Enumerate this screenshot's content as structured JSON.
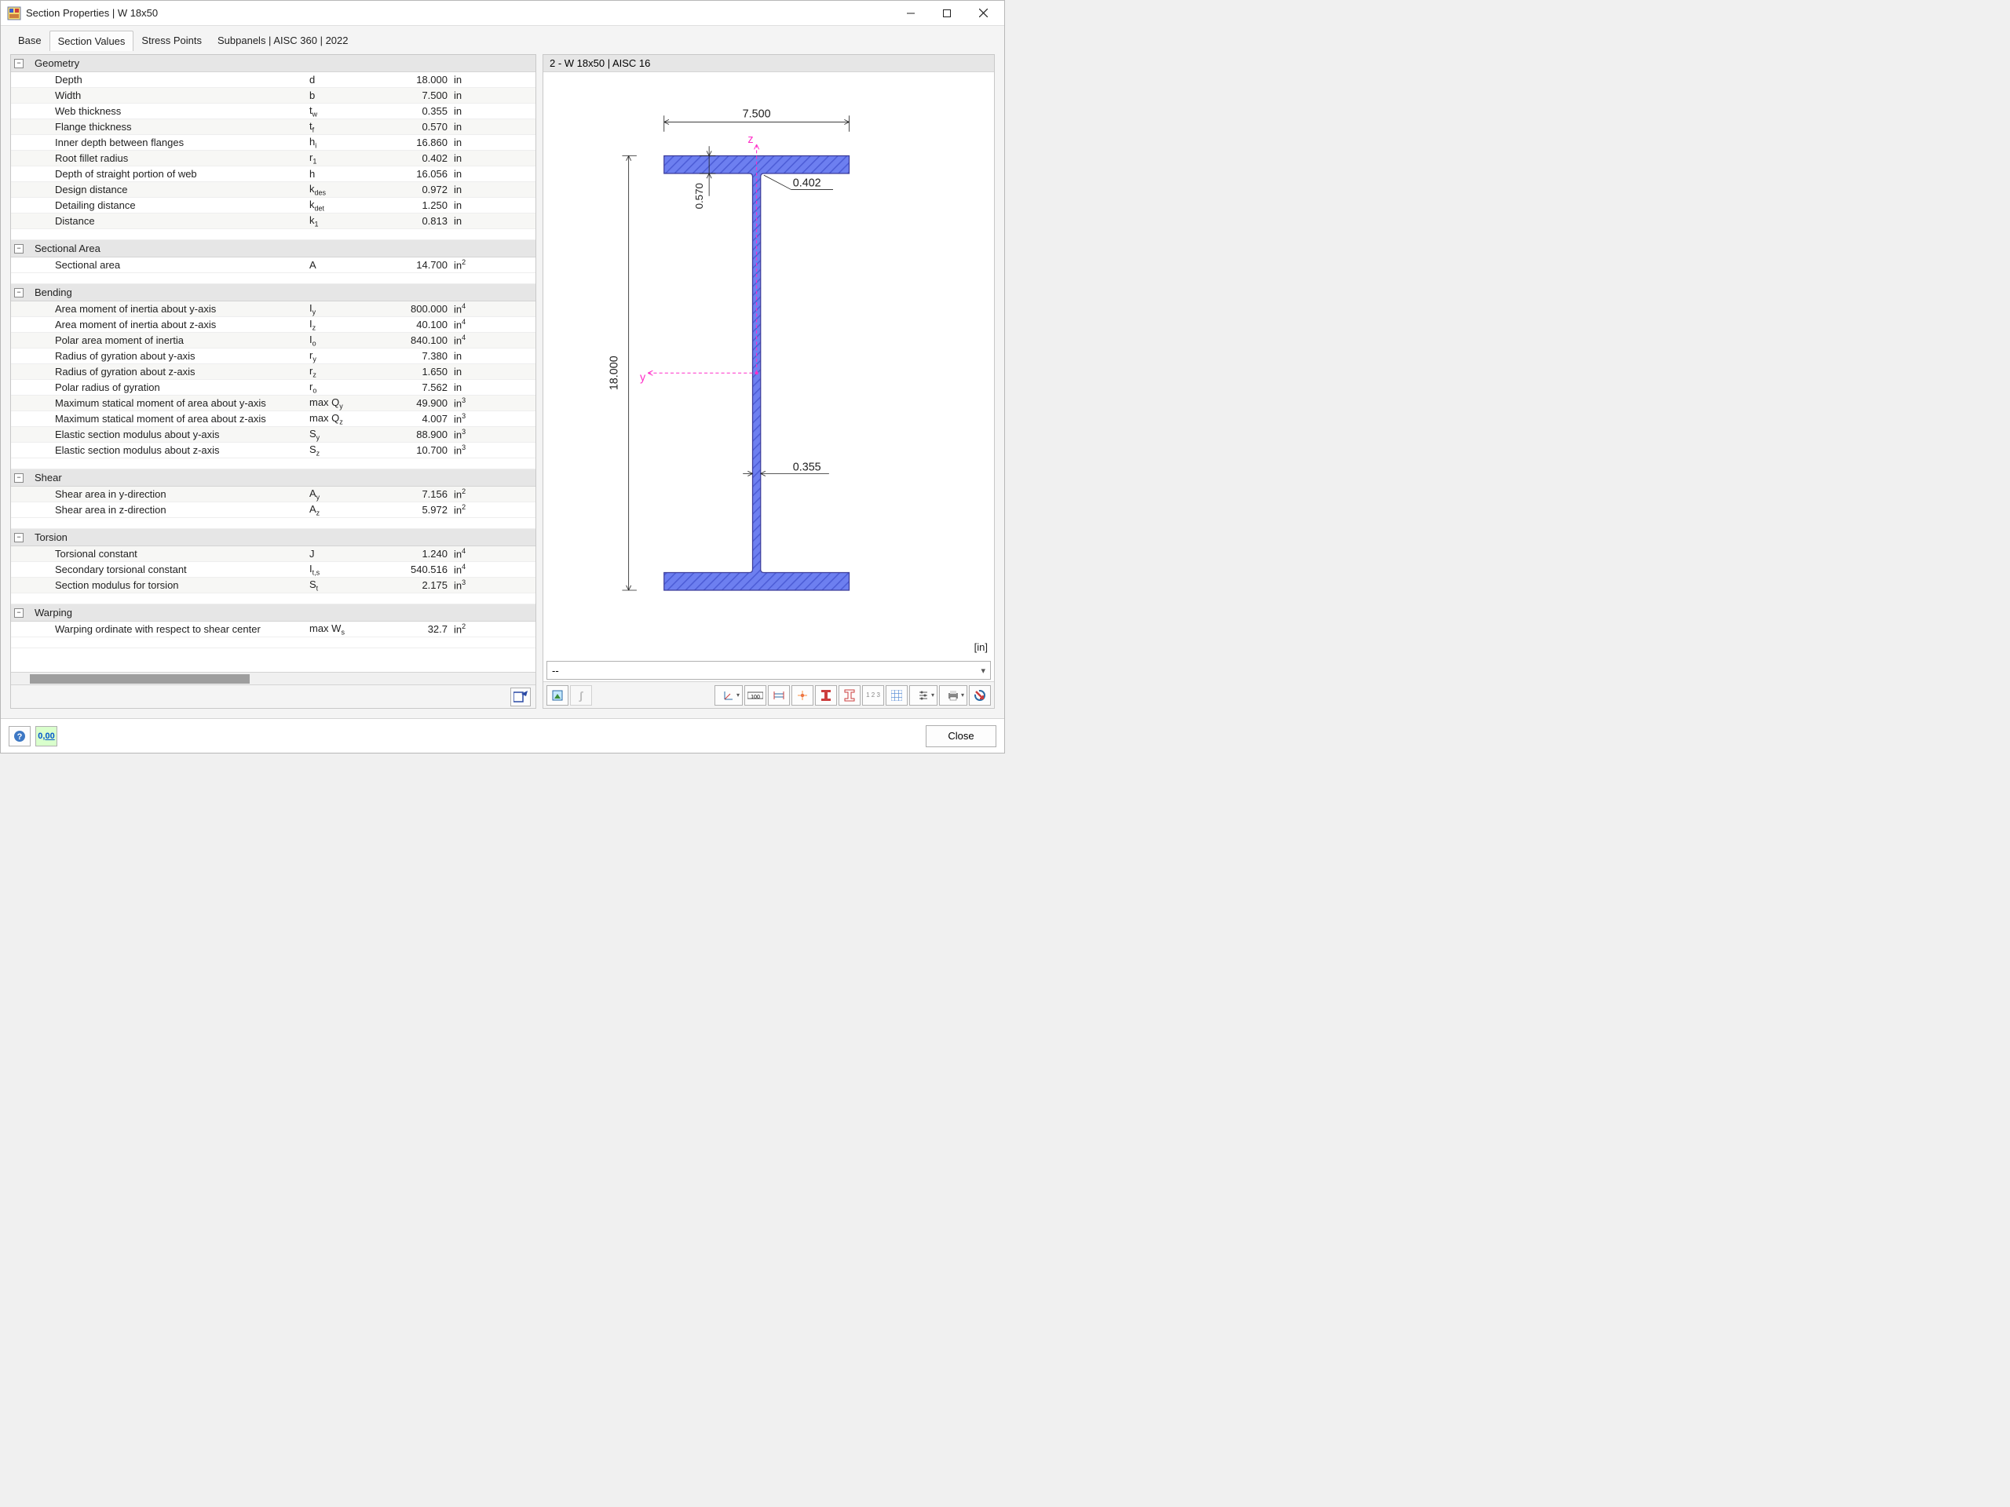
{
  "window": {
    "title": "Section Properties | W 18x50"
  },
  "tabs": [
    {
      "label": "Base",
      "active": false
    },
    {
      "label": "Section Values",
      "active": true
    },
    {
      "label": "Stress Points",
      "active": false
    },
    {
      "label": "Subpanels | AISC 360 | 2022",
      "active": false
    }
  ],
  "right": {
    "header": "2 - W 18x50 | AISC 16",
    "units": "[in]",
    "combo_value": "--"
  },
  "footer": {
    "close": "Close"
  },
  "groups": [
    {
      "name": "Geometry",
      "rows": [
        {
          "desc": "Depth",
          "sym": "d",
          "val": "18.000",
          "unit": "in"
        },
        {
          "desc": "Width",
          "sym": "b",
          "val": "7.500",
          "unit": "in"
        },
        {
          "desc": "Web thickness",
          "sym": "t<sub>w</sub>",
          "val": "0.355",
          "unit": "in"
        },
        {
          "desc": "Flange thickness",
          "sym": "t<sub>f</sub>",
          "val": "0.570",
          "unit": "in"
        },
        {
          "desc": "Inner depth between flanges",
          "sym": "h<sub>i</sub>",
          "val": "16.860",
          "unit": "in"
        },
        {
          "desc": "Root fillet radius",
          "sym": "r<sub>1</sub>",
          "val": "0.402",
          "unit": "in"
        },
        {
          "desc": "Depth of straight portion of web",
          "sym": "h",
          "val": "16.056",
          "unit": "in"
        },
        {
          "desc": "Design distance",
          "sym": "k<sub>des</sub>",
          "val": "0.972",
          "unit": "in"
        },
        {
          "desc": "Detailing distance",
          "sym": "k<sub>det</sub>",
          "val": "1.250",
          "unit": "in"
        },
        {
          "desc": "Distance",
          "sym": "k<sub>1</sub>",
          "val": "0.813",
          "unit": "in"
        }
      ]
    },
    {
      "name": "Sectional Area",
      "rows": [
        {
          "desc": "Sectional area",
          "sym": "A",
          "val": "14.700",
          "unit": "in<sup>2</sup>"
        }
      ]
    },
    {
      "name": "Bending",
      "rows": [
        {
          "desc": "Area moment of inertia about y-axis",
          "sym": "I<sub>y</sub>",
          "val": "800.000",
          "unit": "in<sup>4</sup>"
        },
        {
          "desc": "Area moment of inertia about z-axis",
          "sym": "I<sub>z</sub>",
          "val": "40.100",
          "unit": "in<sup>4</sup>"
        },
        {
          "desc": "Polar area moment of inertia",
          "sym": "I<sub>o</sub>",
          "val": "840.100",
          "unit": "in<sup>4</sup>"
        },
        {
          "desc": "Radius of gyration about y-axis",
          "sym": "r<sub>y</sub>",
          "val": "7.380",
          "unit": "in"
        },
        {
          "desc": "Radius of gyration about z-axis",
          "sym": "r<sub>z</sub>",
          "val": "1.650",
          "unit": "in"
        },
        {
          "desc": "Polar radius of gyration",
          "sym": "r<sub>o</sub>",
          "val": "7.562",
          "unit": "in"
        },
        {
          "desc": "Maximum statical moment of area about y-axis",
          "sym": "max Q<sub>y</sub>",
          "val": "49.900",
          "unit": "in<sup>3</sup>"
        },
        {
          "desc": "Maximum statical moment of area about z-axis",
          "sym": "max Q<sub>z</sub>",
          "val": "4.007",
          "unit": "in<sup>3</sup>"
        },
        {
          "desc": "Elastic section modulus about y-axis",
          "sym": "S<sub>y</sub>",
          "val": "88.900",
          "unit": "in<sup>3</sup>"
        },
        {
          "desc": "Elastic section modulus about z-axis",
          "sym": "S<sub>z</sub>",
          "val": "10.700",
          "unit": "in<sup>3</sup>"
        }
      ]
    },
    {
      "name": "Shear",
      "rows": [
        {
          "desc": "Shear area in y-direction",
          "sym": "A<sub>y</sub>",
          "val": "7.156",
          "unit": "in<sup>2</sup>"
        },
        {
          "desc": "Shear area in z-direction",
          "sym": "A<sub>z</sub>",
          "val": "5.972",
          "unit": "in<sup>2</sup>"
        }
      ]
    },
    {
      "name": "Torsion",
      "rows": [
        {
          "desc": "Torsional constant",
          "sym": "J",
          "val": "1.240",
          "unit": "in<sup>4</sup>"
        },
        {
          "desc": "Secondary torsional constant",
          "sym": "I<sub>t,s</sub>",
          "val": "540.516",
          "unit": "in<sup>4</sup>"
        },
        {
          "desc": "Section modulus for torsion",
          "sym": "S<sub>t</sub>",
          "val": "2.175",
          "unit": "in<sup>3</sup>"
        }
      ]
    },
    {
      "name": "Warping",
      "rows": [
        {
          "desc": "Warping ordinate with respect to shear center",
          "sym": "max W<sub>s</sub>",
          "val": "32.7",
          "unit": "in<sup>2</sup>"
        }
      ]
    }
  ],
  "diagram": {
    "width_label": "7.500",
    "depth_label": "18.000",
    "tf_label": "0.570",
    "fillet_label": "0.402",
    "tw_label": "0.355",
    "y_axis": "y",
    "z_axis": "z"
  }
}
